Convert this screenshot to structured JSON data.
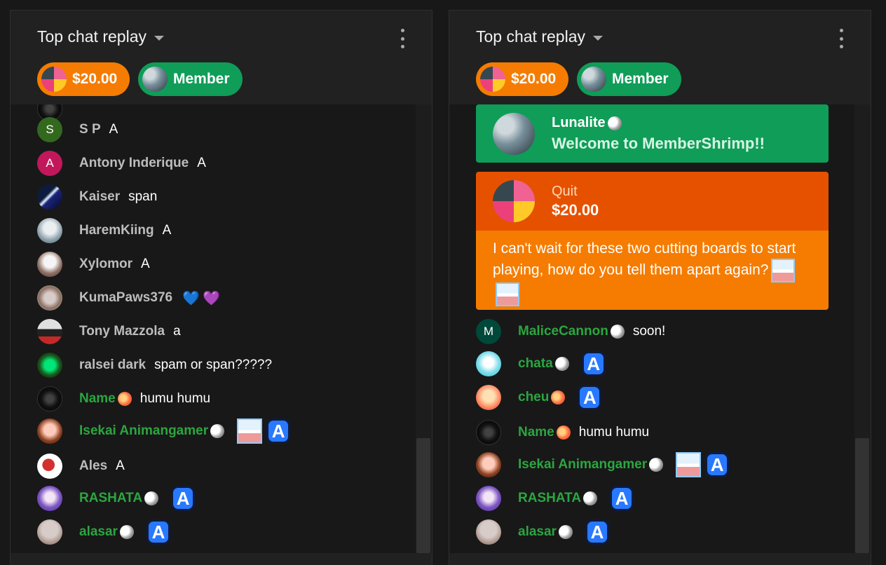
{
  "colors": {
    "background": "#181818",
    "panel": "#212121",
    "member_green": "#0f9d58",
    "superchat_orange": "#f57c00",
    "superchat_header": "#e65100",
    "member_name": "#2ba640"
  },
  "left_panel": {
    "header": {
      "title": "Top chat replay"
    },
    "chips": {
      "dollar": "$20.00",
      "member": "Member"
    },
    "messages": [
      {
        "author": "S P",
        "initial": "S",
        "text": "A"
      },
      {
        "author": "Antony Inderique",
        "initial": "A",
        "text": "A"
      },
      {
        "author": "Kaiser",
        "text": "span"
      },
      {
        "author": "HaremKiing",
        "text": "A"
      },
      {
        "author": "Xylomor",
        "text": "A"
      },
      {
        "author": "KumaPaws376",
        "text": "",
        "emoji": [
          "💙",
          "💜"
        ]
      },
      {
        "author": "Tony Mazzola",
        "text": "a"
      },
      {
        "author": "ralsei dark",
        "text": "spam or span?????"
      },
      {
        "author": "Name",
        "text": "humu humu",
        "member": true
      },
      {
        "author": "Isekai Animangamer",
        "text": "",
        "member": true,
        "emotes": [
          "face-emote",
          "a-emote"
        ]
      },
      {
        "author": "Ales",
        "text": "A"
      },
      {
        "author": "RASHATA",
        "text": "",
        "member": true,
        "emotes": [
          "a-emote"
        ]
      },
      {
        "author": "alasar",
        "text": "",
        "member": true,
        "emotes": [
          "a-emote"
        ]
      }
    ]
  },
  "right_panel": {
    "header": {
      "title": "Top chat replay"
    },
    "chips": {
      "dollar": "$20.00",
      "member": "Member"
    },
    "member_card": {
      "name": "Lunalite",
      "message": "Welcome to MemberShrimp!!"
    },
    "paid_card": {
      "name": "Quit",
      "amount": "$20.00",
      "message": "I can't wait for these two cutting boards to start playing, how do you tell them apart again?"
    },
    "messages": [
      {
        "author": "MaliceCannon",
        "initial": "M",
        "text": "soon!",
        "member": true
      },
      {
        "author": "chata",
        "text": "",
        "member": true,
        "emotes": [
          "a-emote"
        ]
      },
      {
        "author": "cheu",
        "text": "",
        "member": true,
        "emotes": [
          "a-emote"
        ]
      },
      {
        "author": "Name",
        "text": "humu humu",
        "member": true
      },
      {
        "author": "Isekai Animangamer",
        "text": "",
        "member": true,
        "emotes": [
          "face-emote",
          "a-emote"
        ]
      },
      {
        "author": "RASHATA",
        "text": "",
        "member": true,
        "emotes": [
          "a-emote"
        ]
      },
      {
        "author": "alasar",
        "text": "",
        "member": true,
        "emotes": [
          "a-emote"
        ]
      }
    ]
  }
}
